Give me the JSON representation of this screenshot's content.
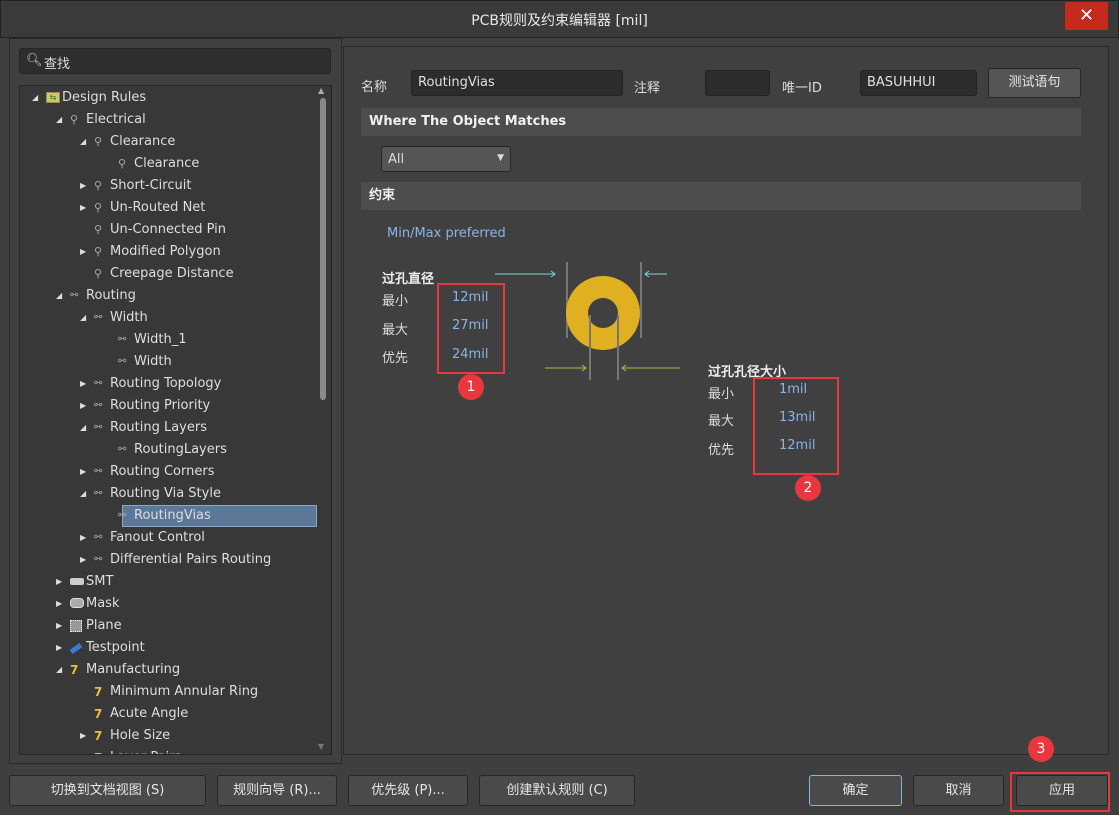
{
  "window": {
    "title": "PCB规则及约束编辑器 [mil]",
    "close_icon": "close-icon"
  },
  "search": {
    "placeholder": "查找"
  },
  "tree": [
    {
      "label": "Design Rules",
      "level": 0,
      "state": "expanded",
      "icon": "folder-rules"
    },
    {
      "label": "Electrical",
      "level": 1,
      "state": "expanded",
      "icon": "electrical"
    },
    {
      "label": "Clearance",
      "level": 2,
      "state": "expanded",
      "icon": "electrical"
    },
    {
      "label": "Clearance",
      "level": 3,
      "state": "none",
      "icon": "electrical"
    },
    {
      "label": "Short-Circuit",
      "level": 2,
      "state": "collapsed",
      "icon": "electrical"
    },
    {
      "label": "Un-Routed Net",
      "level": 2,
      "state": "collapsed",
      "icon": "electrical"
    },
    {
      "label": "Un-Connected Pin",
      "level": 2,
      "state": "none",
      "icon": "electrical"
    },
    {
      "label": "Modified Polygon",
      "level": 2,
      "state": "collapsed",
      "icon": "electrical"
    },
    {
      "label": "Creepage Distance",
      "level": 2,
      "state": "none",
      "icon": "electrical"
    },
    {
      "label": "Routing",
      "level": 1,
      "state": "expanded",
      "icon": "routing"
    },
    {
      "label": "Width",
      "level": 2,
      "state": "expanded",
      "icon": "routing"
    },
    {
      "label": "Width_1",
      "level": 3,
      "state": "none",
      "icon": "routing"
    },
    {
      "label": "Width",
      "level": 3,
      "state": "none",
      "icon": "routing"
    },
    {
      "label": "Routing Topology",
      "level": 2,
      "state": "collapsed",
      "icon": "routing"
    },
    {
      "label": "Routing Priority",
      "level": 2,
      "state": "collapsed",
      "icon": "routing"
    },
    {
      "label": "Routing Layers",
      "level": 2,
      "state": "expanded",
      "icon": "routing"
    },
    {
      "label": "RoutingLayers",
      "level": 3,
      "state": "none",
      "icon": "routing"
    },
    {
      "label": "Routing Corners",
      "level": 2,
      "state": "collapsed",
      "icon": "routing"
    },
    {
      "label": "Routing Via Style",
      "level": 2,
      "state": "expanded",
      "icon": "routing"
    },
    {
      "label": "RoutingVias",
      "level": 3,
      "state": "none",
      "icon": "routing",
      "selected": true
    },
    {
      "label": "Fanout Control",
      "level": 2,
      "state": "collapsed",
      "icon": "routing"
    },
    {
      "label": "Differential Pairs Routing",
      "level": 2,
      "state": "collapsed",
      "icon": "routing"
    },
    {
      "label": "SMT",
      "level": 1,
      "state": "collapsed",
      "icon": "smt"
    },
    {
      "label": "Mask",
      "level": 1,
      "state": "collapsed",
      "icon": "mask"
    },
    {
      "label": "Plane",
      "level": 1,
      "state": "collapsed",
      "icon": "plane"
    },
    {
      "label": "Testpoint",
      "level": 1,
      "state": "collapsed",
      "icon": "testpoint"
    },
    {
      "label": "Manufacturing",
      "level": 1,
      "state": "expanded",
      "icon": "manufacturing"
    },
    {
      "label": "Minimum Annular Ring",
      "level": 2,
      "state": "none",
      "icon": "manufacturing"
    },
    {
      "label": "Acute Angle",
      "level": 2,
      "state": "none",
      "icon": "manufacturing"
    },
    {
      "label": "Hole Size",
      "level": 2,
      "state": "collapsed",
      "icon": "manufacturing"
    },
    {
      "label": "Layer Pairs",
      "level": 2,
      "state": "none",
      "icon": "manufacturing"
    }
  ],
  "rule": {
    "name_label": "名称",
    "name_value": "RoutingVias",
    "comment_label": "注释",
    "comment_value": "",
    "id_label": "唯一ID",
    "id_value": "BASUHHUI",
    "test_button": "测试语句"
  },
  "where": {
    "title": "Where The Object Matches",
    "scope": "All"
  },
  "constraints": {
    "title": "约束",
    "mode": "Min/Max preferred",
    "diameter": {
      "title": "过孔直径",
      "min_label": "最小",
      "min": "12mil",
      "max_label": "最大",
      "max": "27mil",
      "pref_label": "优先",
      "pref": "24mil"
    },
    "hole": {
      "title": "过孔孔径大小",
      "min_label": "最小",
      "min": "1mil",
      "max_label": "最大",
      "max": "13mil",
      "pref_label": "优先",
      "pref": "12mil"
    }
  },
  "annotations": [
    "1",
    "2",
    "3"
  ],
  "buttons": {
    "doc_view": "切换到文档视图 (S)",
    "wizard": "规则向导 (R)...",
    "priority": "优先级 (P)...",
    "defaults": "创建默认规则 (C)",
    "ok": "确定",
    "cancel": "取消",
    "apply": "应用"
  },
  "colors": {
    "via_copper": "#e0b020",
    "selection": "#5b7899",
    "value_text": "#8ab4e8",
    "annotation": "#e8383d"
  }
}
